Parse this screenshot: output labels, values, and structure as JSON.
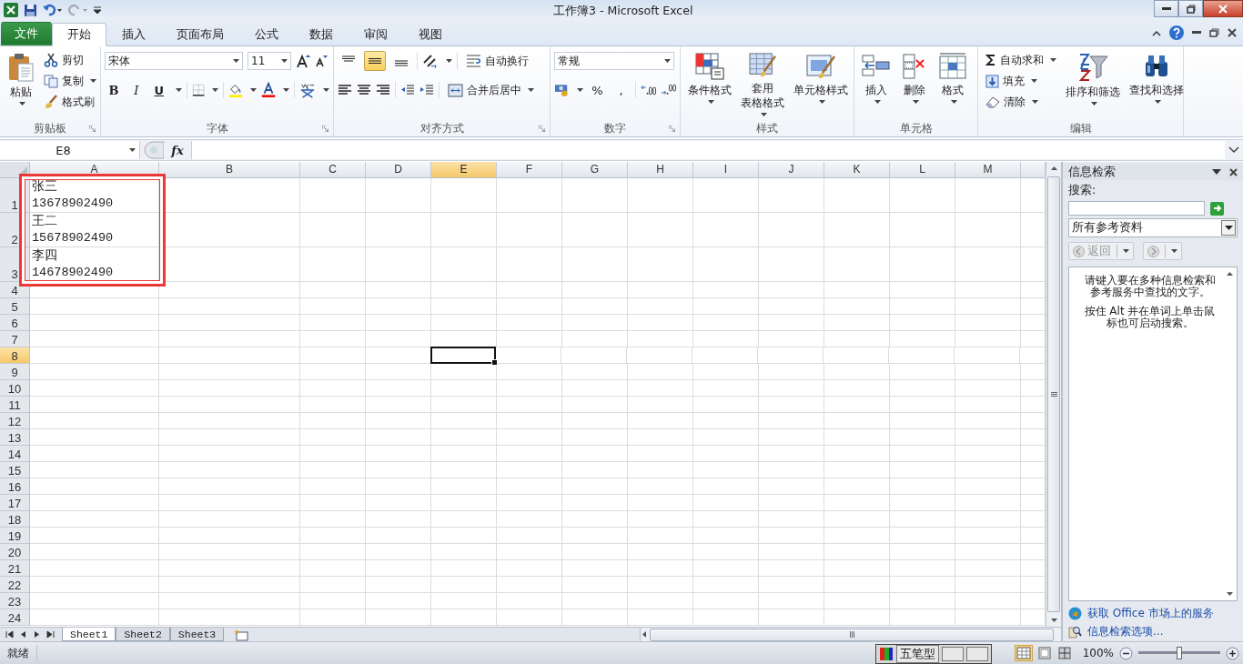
{
  "title_bar": {
    "title": "工作簿3 - Microsoft Excel"
  },
  "tabs": [
    {
      "label": "文件",
      "kind": "file",
      "selected": false
    },
    {
      "label": "开始",
      "kind": "tab",
      "selected": true
    },
    {
      "label": "插入",
      "kind": "tab",
      "selected": false
    },
    {
      "label": "页面布局",
      "kind": "tab",
      "selected": false
    },
    {
      "label": "公式",
      "kind": "tab",
      "selected": false
    },
    {
      "label": "数据",
      "kind": "tab",
      "selected": false
    },
    {
      "label": "审阅",
      "kind": "tab",
      "selected": false
    },
    {
      "label": "视图",
      "kind": "tab",
      "selected": false
    }
  ],
  "clipboard": {
    "label": "剪贴板",
    "paste": "粘贴",
    "cut": "剪切",
    "copy": "复制",
    "format_painter": "格式刷"
  },
  "font": {
    "label": "字体",
    "name": "宋体",
    "size": "11",
    "bold": "B",
    "italic": "I",
    "underline": "U"
  },
  "alignment": {
    "label": "对齐方式",
    "vertical": [
      {
        "selected": false
      },
      {
        "selected": true
      },
      {
        "selected": false
      }
    ],
    "wrap": "自动换行",
    "merge": "合并后居中"
  },
  "number": {
    "label": "数字",
    "format": "常规",
    "percent": "%",
    "comma": ","
  },
  "styles": {
    "label": "样式",
    "conditional": "条件格式",
    "table_format": [
      "套用",
      "表格格式"
    ],
    "cell_styles": "单元格样式"
  },
  "cells": {
    "label": "单元格",
    "insert": "插入",
    "delete": "删除",
    "format": "格式"
  },
  "editing": {
    "label": "编辑",
    "autosum": "自动求和",
    "fill": "填充",
    "clear": "清除",
    "sort": "排序和筛选",
    "find": "查找和选择"
  },
  "formula_bar": {
    "name_box": "E8",
    "fx": "fx"
  },
  "sheet": {
    "columns": [
      {
        "label": "A",
        "selected": false
      },
      {
        "label": "B",
        "selected": false
      },
      {
        "label": "C",
        "selected": false
      },
      {
        "label": "D",
        "selected": false
      },
      {
        "label": "E",
        "selected": true
      },
      {
        "label": "F",
        "selected": false
      },
      {
        "label": "G",
        "selected": false
      },
      {
        "label": "H",
        "selected": false
      },
      {
        "label": "I",
        "selected": false
      },
      {
        "label": "J",
        "selected": false
      },
      {
        "label": "K",
        "selected": false
      },
      {
        "label": "L",
        "selected": false
      },
      {
        "label": "M",
        "selected": false
      }
    ],
    "rows": [
      {
        "label": "1",
        "selected": false,
        "cells": [
          {
            "lines": [
              "张三",
              "13678902490"
            ]
          }
        ]
      },
      {
        "label": "2",
        "selected": false,
        "cells": [
          {
            "lines": [
              "王二",
              "15678902490"
            ]
          }
        ]
      },
      {
        "label": "3",
        "selected": false,
        "cells": [
          {
            "lines": [
              "李四",
              "14678902490"
            ]
          }
        ]
      },
      {
        "label": "4",
        "selected": false
      },
      {
        "label": "5",
        "selected": false
      },
      {
        "label": "6",
        "selected": false
      },
      {
        "label": "7",
        "selected": false
      },
      {
        "label": "8",
        "selected": true
      },
      {
        "label": "9",
        "selected": false
      },
      {
        "label": "10",
        "selected": false
      },
      {
        "label": "11",
        "selected": false
      },
      {
        "label": "12",
        "selected": false
      },
      {
        "label": "13",
        "selected": false
      },
      {
        "label": "14",
        "selected": false
      },
      {
        "label": "15",
        "selected": false
      },
      {
        "label": "16",
        "selected": false
      },
      {
        "label": "17",
        "selected": false
      },
      {
        "label": "18",
        "selected": false
      },
      {
        "label": "19",
        "selected": false
      },
      {
        "label": "20",
        "selected": false
      },
      {
        "label": "21",
        "selected": false
      },
      {
        "label": "22",
        "selected": false
      },
      {
        "label": "23",
        "selected": false
      },
      {
        "label": "24",
        "selected": false
      }
    ]
  },
  "sheet_tabs": [
    {
      "label": "Sheet1",
      "selected": true
    },
    {
      "label": "Sheet2",
      "selected": false
    },
    {
      "label": "Sheet3",
      "selected": false
    }
  ],
  "task_pane": {
    "title": "信息检索",
    "search_label": "搜索:",
    "source": "所有参考资料",
    "back": "返回",
    "message": [
      "请键入要在多种信息检索和参考服务中查找的文字。",
      "按住 Alt 并在单词上单击鼠标也可启动搜索。"
    ],
    "links": [
      "获取 Office 市场上的服务",
      "信息检索选项..."
    ]
  },
  "status_bar": {
    "status": "就绪",
    "ime": "五笔型",
    "zoom": "100%",
    "zoom_slider": {
      "level": 0.5
    }
  }
}
